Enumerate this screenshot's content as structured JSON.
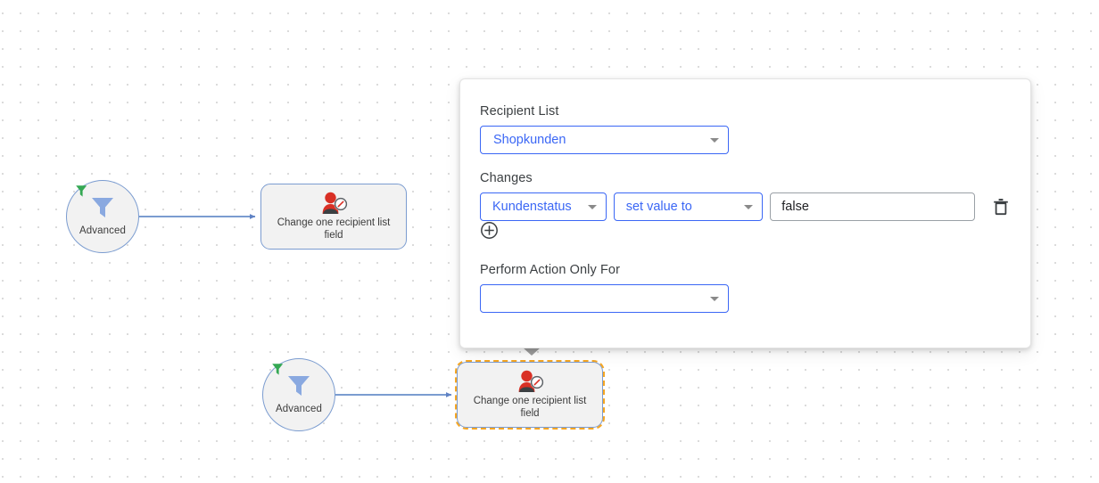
{
  "canvas": {
    "background_color": "#ffffff",
    "dot_color": "#cfcfcf"
  },
  "flow": {
    "nodes": [
      {
        "id": "filter-top",
        "type": "filter-circle",
        "label": "Advanced",
        "icon": "funnel-icon",
        "badge_icon": "funnel-green-badge-icon",
        "selected": false
      },
      {
        "id": "action-top",
        "type": "action-rect",
        "label": "Change one recipient list field",
        "icon": "recipient-edit-icon",
        "selected": false
      },
      {
        "id": "filter-bottom",
        "type": "filter-circle",
        "label": "Advanced",
        "icon": "funnel-icon",
        "badge_icon": "funnel-green-badge-icon",
        "selected": false
      },
      {
        "id": "action-bottom",
        "type": "action-rect",
        "label": "Change one recipient list field",
        "icon": "recipient-edit-icon",
        "selected": true
      }
    ],
    "colors": {
      "node_border": "#7b9cd0",
      "node_fill": "#f2f2f2",
      "edge": "#7b9cd0",
      "selection": "#f5a623",
      "icon_red": "#d93025",
      "icon_blue": "#8aa9e0",
      "badge_green": "#34a853"
    }
  },
  "panel": {
    "recipient_list": {
      "label": "Recipient List",
      "value": "Shopkunden",
      "caret_icon": "chevron-down-icon"
    },
    "changes": {
      "label": "Changes",
      "rows": [
        {
          "field": "Kundenstatus",
          "operator": "set value to",
          "value": "false",
          "value_placeholder": "",
          "delete_icon": "trash-icon"
        }
      ],
      "add_icon": "add-circle-icon"
    },
    "perform_action_only_for": {
      "label": "Perform Action Only For",
      "value": "",
      "placeholder": "",
      "caret_icon": "chevron-down-icon"
    },
    "colors": {
      "accent": "#3b67f5",
      "label_text": "#3c4043",
      "input_border": "#9aa0a6",
      "input_text": "#202124"
    }
  }
}
